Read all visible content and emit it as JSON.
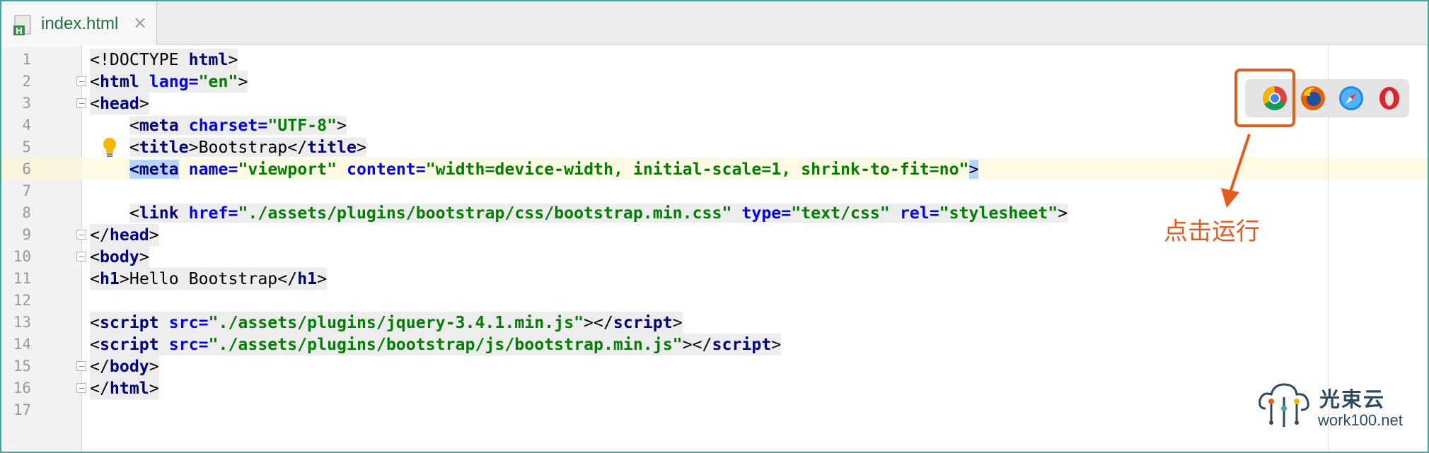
{
  "tab": {
    "filename": "index.html",
    "close": "×"
  },
  "line_numbers": [
    "1",
    "2",
    "3",
    "4",
    "5",
    "6",
    "7",
    "8",
    "9",
    "10",
    "11",
    "12",
    "13",
    "14",
    "15",
    "16",
    "17"
  ],
  "code": {
    "l1": {
      "a": "<!DOCTYPE ",
      "b": "html",
      "c": ">"
    },
    "l2": {
      "a": "<",
      "tag": "html",
      "sp": " ",
      "attr": "lang=",
      "val": "\"en\"",
      "end": ">"
    },
    "l3": {
      "a": "<",
      "tag": "head",
      "end": ">"
    },
    "l4": {
      "indent": "    ",
      "a": "<",
      "tag": "meta",
      "sp": " ",
      "attr": "charset=",
      "val": "\"UTF-8\"",
      "end": ">"
    },
    "l5": {
      "indent": "    ",
      "a": "<",
      "tag": "title",
      "b": ">",
      "text": "Bootstrap",
      "c": "</",
      "tag2": "title",
      "end": ">"
    },
    "l6": {
      "indent": "    ",
      "sel1": "<meta",
      "sp": " ",
      "attr1": "name=",
      "val1": "\"viewport\"",
      "sp2": " ",
      "attr2": "content=",
      "val2": "\"width=device-width, initial-scale=1, shrink-to-fit=no\"",
      "sel2": ">"
    },
    "l8": {
      "indent": "    ",
      "a": "<",
      "tag": "link",
      "sp": " ",
      "attr1": "href=",
      "val1": "\"./assets/plugins/bootstrap/css/bootstrap.min.css\"",
      "sp2": " ",
      "attr2": "type=",
      "val2": "\"text/css\"",
      "sp3": " ",
      "attr3": "rel=",
      "val3": "\"stylesheet\"",
      "end": ">"
    },
    "l9": {
      "a": "</",
      "tag": "head",
      "end": ">"
    },
    "l10": {
      "a": "<",
      "tag": "body",
      "end": ">"
    },
    "l11": {
      "a": "<",
      "tag": "h1",
      "b": ">",
      "text": "Hello Bootstrap",
      "c": "</",
      "tag2": "h1",
      "end": ">"
    },
    "l13": {
      "a": "<",
      "tag": "script",
      "sp": " ",
      "attr": "src=",
      "val": "\"./assets/plugins/jquery-3.4.1.min.js\"",
      "b": "></",
      "tag2": "script",
      "end": ">"
    },
    "l14": {
      "a": "<",
      "tag": "script",
      "sp": " ",
      "attr": "src=",
      "val": "\"./assets/plugins/bootstrap/js/bootstrap.min.js\"",
      "b": "></",
      "tag2": "script",
      "end": ">"
    },
    "l15": {
      "a": "</",
      "tag": "body",
      "end": ">"
    },
    "l16": {
      "a": "</",
      "tag": "html",
      "end": ">"
    }
  },
  "browsers": [
    "chrome-icon",
    "firefox-icon",
    "safari-icon",
    "opera-icon"
  ],
  "annotation": "点击运行",
  "watermark": {
    "name": "光束云",
    "url": "work100.net"
  },
  "colors": {
    "accent": "#e85a1a",
    "tag": "#000080",
    "attr": "#0000ff",
    "value": "#008000",
    "frame": "#3fa7a0"
  }
}
